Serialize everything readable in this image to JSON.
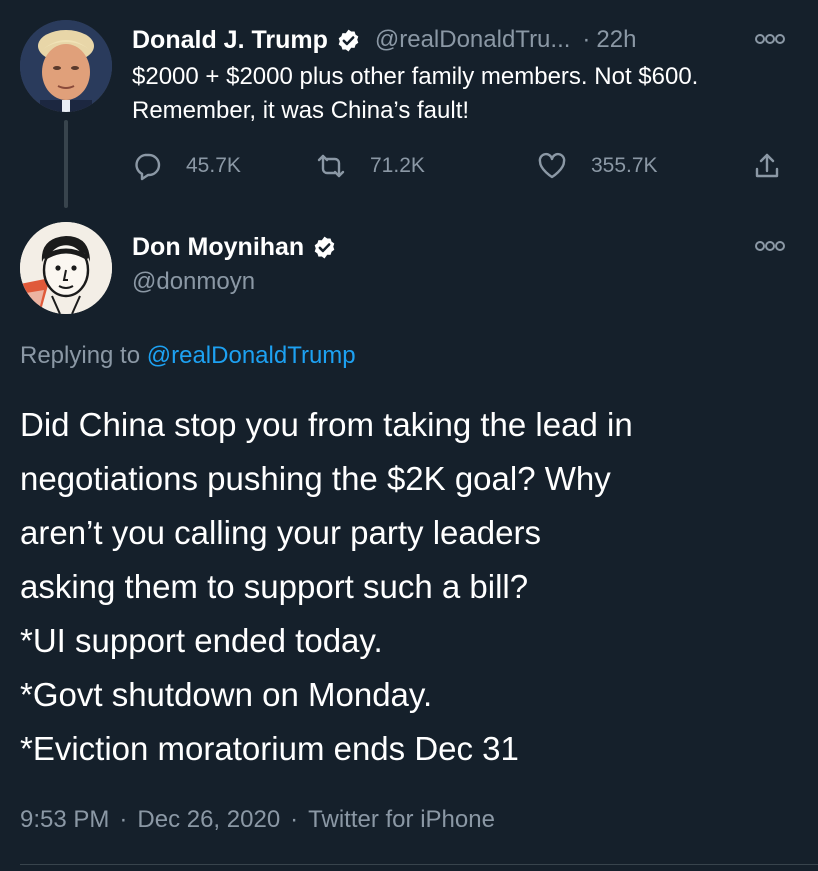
{
  "parent_tweet": {
    "author_name": "Donald J. Trump",
    "handle": "@realDonaldTru...",
    "separator": "·",
    "time_ago": "22h",
    "avatar_icon": "avatar-photo",
    "verified_icon": "verified-badge-icon",
    "more_icon": "more-options-icon",
    "text": "$2000 + $2000 plus other family members. Not $600. Remember, it was China’s fault!",
    "actions": {
      "replies": "45.7K",
      "retweets": "71.2K",
      "likes": "355.7K"
    }
  },
  "tweet": {
    "author_name": "Don Moynihan",
    "handle": "@donmoyn",
    "avatar_icon": "avatar-illustration",
    "verified_icon": "verified-badge-icon",
    "more_icon": "more-options-icon",
    "replying_prefix": "Replying to ",
    "replying_to": "@realDonaldTrump",
    "text_lines": [
      "Did China stop you from taking the lead in",
      "negotiations pushing the $2K goal? Why",
      "aren’t you calling your party leaders",
      "asking them to support such a bill?",
      "*UI support ended today.",
      "*Govt shutdown on Monday.",
      "*Eviction moratorium ends Dec 31"
    ],
    "time": "9:53 PM",
    "date": "Dec 26, 2020",
    "source": "Twitter for iPhone",
    "meta_separator": "·"
  },
  "colors": {
    "background": "#15202b",
    "text_primary": "#ffffff",
    "text_secondary": "#8b98a5",
    "link": "#1da1f2",
    "divider": "#38444d"
  }
}
